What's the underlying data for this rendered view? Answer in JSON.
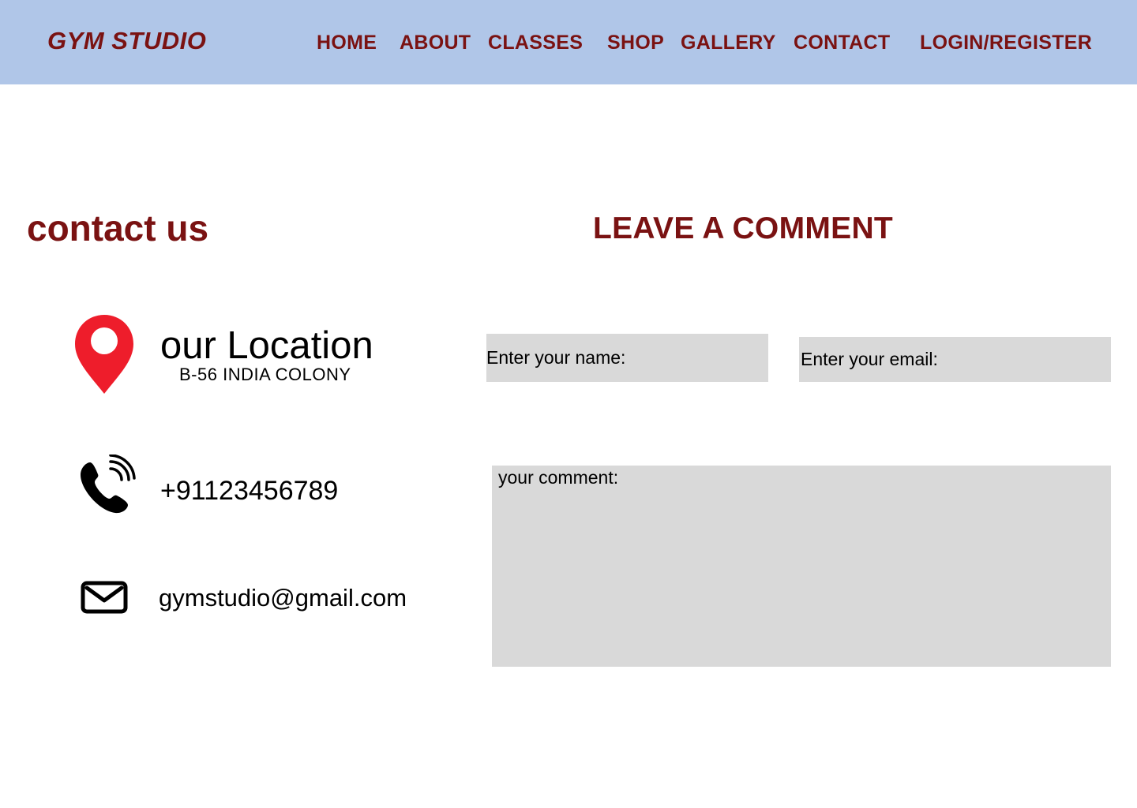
{
  "header": {
    "logo": "GYM STUDIO",
    "nav": [
      "HOME",
      "ABOUT",
      "CLASSES",
      "SHOP",
      "GALLERY",
      "CONTACT",
      "LOGIN/REGISTER"
    ],
    "background_color": "#b0c6e8",
    "brand_color": "#7a1212"
  },
  "contact": {
    "heading": "contact us",
    "location": {
      "icon": "map-pin-icon",
      "title": "our Location",
      "address": "B-56 INDIA COLONY"
    },
    "phone": {
      "icon": "phone-icon",
      "number": "+91123456789"
    },
    "email": {
      "icon": "mail-icon",
      "address": "gymstudio@gmail.com"
    }
  },
  "comment_form": {
    "heading": "LEAVE A COMMENT",
    "name_placeholder": "Enter your name:",
    "email_placeholder": "Enter your email:",
    "comment_placeholder": "your comment:",
    "field_color": "#d9d9d9"
  },
  "colors": {
    "pin_red": "#ee1d2b"
  }
}
